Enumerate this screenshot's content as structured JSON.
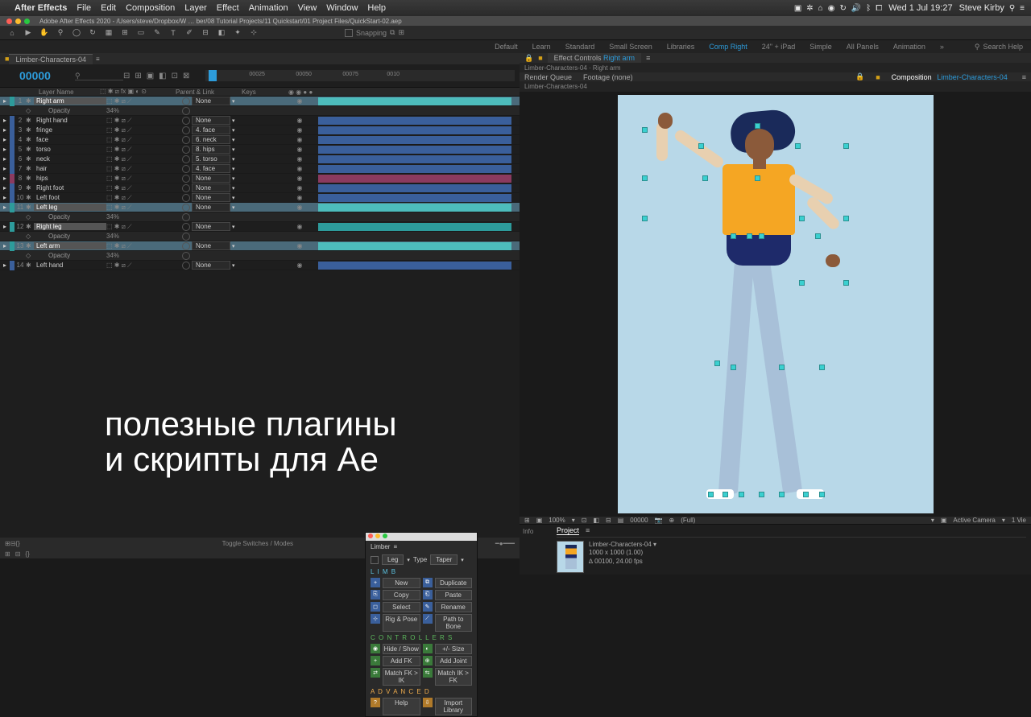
{
  "menubar": {
    "app": "After Effects",
    "items": [
      "File",
      "Edit",
      "Composition",
      "Layer",
      "Effect",
      "Animation",
      "View",
      "Window",
      "Help"
    ],
    "clock": "Wed 1 Jul 19:27",
    "user": "Steve Kirby"
  },
  "titlebar": {
    "path": "Adobe After Effects 2020 - /Users/steve/Dropbox/W … ber/08 Tutorial Projects/11 Quickstart/01 Project Files/QuickStart-02.aep"
  },
  "toolbar": {
    "snapping": "Snapping"
  },
  "workspaces": {
    "items": [
      "Default",
      "Learn",
      "Standard",
      "Small Screen",
      "Libraries",
      "Comp Right",
      "24\" + iPad",
      "Simple",
      "All Panels",
      "Animation"
    ],
    "active": "Comp Right",
    "search_placeholder": "Search Help"
  },
  "timeline": {
    "tab": "Limber-Characters-04",
    "timecode": "00000",
    "columns": {
      "name": "Layer Name",
      "parent": "Parent & Link",
      "keys": "Keys"
    },
    "ruler": [
      "00025",
      "00050",
      "00075",
      "0010"
    ],
    "layers": [
      {
        "n": "1",
        "name": "Right arm",
        "boxed": true,
        "parent": "None",
        "color": "#2d9b9b",
        "bar": "b-teal-sel",
        "sel": true,
        "eye": true
      },
      {
        "sub": true,
        "name": "Opacity",
        "val": "34%"
      },
      {
        "n": "2",
        "name": "Right hand",
        "parent": "None",
        "color": "#3a5f9b",
        "bar": "b-blue",
        "eye": true
      },
      {
        "n": "3",
        "name": "fringe",
        "parent": "4. face",
        "color": "#3a5f9b",
        "bar": "b-blue",
        "eye": true
      },
      {
        "n": "4",
        "name": "face",
        "parent": "6. neck",
        "color": "#3a5f9b",
        "bar": "b-blue",
        "eye": true
      },
      {
        "n": "5",
        "name": "torso",
        "parent": "8. hips",
        "color": "#3a5f9b",
        "bar": "b-blue",
        "eye": true
      },
      {
        "n": "6",
        "name": "neck",
        "parent": "5. torso",
        "color": "#3a5f9b",
        "bar": "b-blue",
        "eye": true
      },
      {
        "n": "7",
        "name": "hair",
        "parent": "4. face",
        "color": "#3a5f9b",
        "bar": "b-blue",
        "eye": true
      },
      {
        "n": "8",
        "name": "hips",
        "parent": "None",
        "color": "#8b3a5f",
        "bar": "b-pink",
        "eye": true
      },
      {
        "n": "9",
        "name": "Right foot",
        "parent": "None",
        "color": "#3a5f9b",
        "bar": "b-blue",
        "eye": true
      },
      {
        "n": "10",
        "name": "Left foot",
        "parent": "None",
        "color": "#3a5f9b",
        "bar": "b-blue",
        "eye": true
      },
      {
        "n": "11",
        "name": "Left leg",
        "boxed": true,
        "parent": "None",
        "color": "#2d9b9b",
        "bar": "b-teal-sel",
        "sel": true,
        "eye": true
      },
      {
        "sub": true,
        "name": "Opacity",
        "val": "34%"
      },
      {
        "n": "12",
        "name": "Right leg",
        "boxed": true,
        "parent": "None",
        "color": "#2d9b9b",
        "bar": "b-teal",
        "eye": true
      },
      {
        "sub": true,
        "name": "Opacity",
        "val": "34%"
      },
      {
        "n": "13",
        "name": "Left arm",
        "boxed": true,
        "parent": "None",
        "color": "#2d9b9b",
        "bar": "b-teal-sel",
        "sel": true,
        "eye": true
      },
      {
        "sub": true,
        "name": "Opacity",
        "val": "34%"
      },
      {
        "n": "14",
        "name": "Left hand",
        "parent": "None",
        "color": "#3a5f9b",
        "bar": "b-blue",
        "eye": true
      }
    ],
    "footer_toggle": "Toggle Switches / Modes"
  },
  "limber": {
    "title": "Limber",
    "limb_drop": "Leg",
    "type_label": "Type",
    "type_drop": "Taper",
    "sections": {
      "limb": "L I M B",
      "ctrl": "C O N T R O L L E R S",
      "adv": "A D V A N C E D"
    },
    "buttons": {
      "new": "New",
      "dup": "Duplicate",
      "copy": "Copy",
      "paste": "Paste",
      "select": "Select",
      "rename": "Rename",
      "rig": "Rig & Pose",
      "path": "Path to Bone",
      "hide": "Hide / Show",
      "size": "+/- Size",
      "addfk": "Add FK",
      "addjoint": "Add Joint",
      "matchfk": "Match FK > IK",
      "matchik": "Match IK > FK",
      "help": "Help",
      "import": "Import Library"
    }
  },
  "effect_controls": {
    "tab": "Effect Controls",
    "layer": "Right arm",
    "crumb": "Limber-Characters-04 · Right arm"
  },
  "comp_panel": {
    "tabs": {
      "render": "Render Queue",
      "footage": "Footage (none)",
      "comp": "Composition",
      "comp_name": "Limber-Characters-04"
    },
    "crumb": "Limber-Characters-04"
  },
  "viewer_footer": {
    "zoom": "100%",
    "time": "00000",
    "res": "(Full)",
    "camera": "Active Camera",
    "view": "1 Vie"
  },
  "project": {
    "info_tab": "Info",
    "project_tab": "Project",
    "item_name": "Limber-Characters-04 ▾",
    "dims": "1000 x 1000 (1.00)",
    "dur": "∆ 00100, 24.00 fps"
  },
  "overlay": {
    "line1": "полезные плагины",
    "line2": "и скрипты для Ae"
  }
}
